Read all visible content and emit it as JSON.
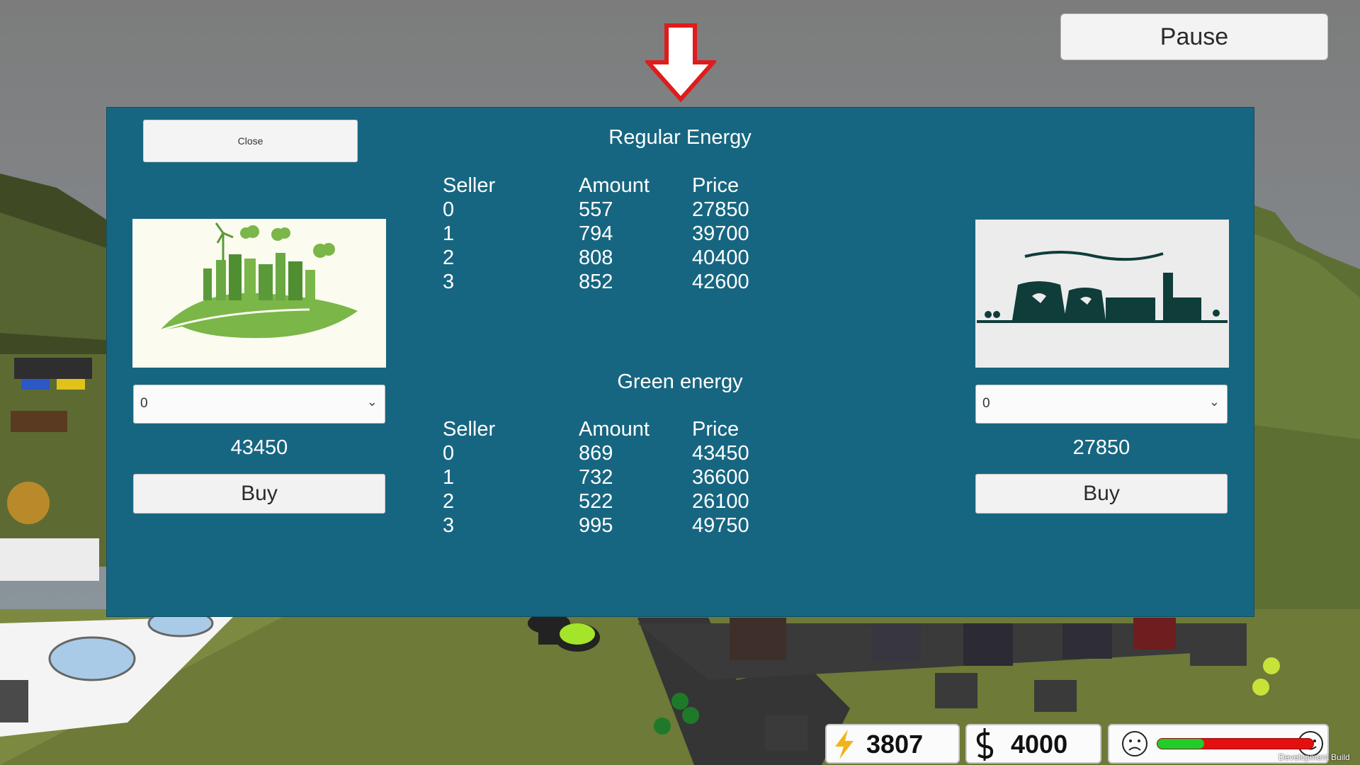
{
  "pause_label": "Pause",
  "close_label": "Close",
  "regular": {
    "title": "Regular Energy",
    "headers": [
      "Seller",
      "Amount",
      "Price"
    ],
    "rows": [
      [
        "0",
        "557",
        "27850"
      ],
      [
        "1",
        "794",
        "39700"
      ],
      [
        "2",
        "808",
        "40400"
      ],
      [
        "3",
        "852",
        "42600"
      ]
    ]
  },
  "green": {
    "title": "Green energy",
    "headers": [
      "Seller",
      "Amount",
      "Price"
    ],
    "rows": [
      [
        "0",
        "869",
        "43450"
      ],
      [
        "1",
        "732",
        "36600"
      ],
      [
        "2",
        "522",
        "26100"
      ],
      [
        "3",
        "995",
        "49750"
      ]
    ]
  },
  "left_card": {
    "image": "green-city-leaf-icon",
    "dropdown_value": "0",
    "price": "43450",
    "buy_label": "Buy"
  },
  "right_card": {
    "image": "power-plant-icon",
    "dropdown_value": "0",
    "price": "27850",
    "buy_label": "Buy"
  },
  "hud": {
    "energy": "3807",
    "money": "4000",
    "happiness_fraction": 0.3,
    "dev_build": "Development Build"
  },
  "colors": {
    "panel": "#176681",
    "bar_good": "#1fce2a",
    "bar_bad": "#e31010"
  }
}
